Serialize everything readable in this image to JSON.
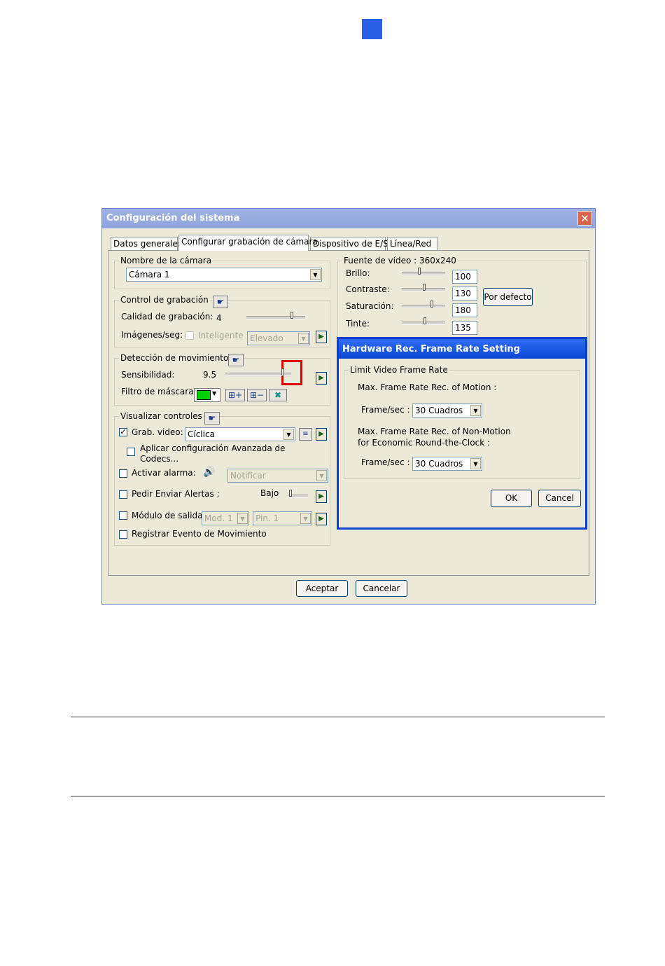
{
  "page": {
    "accent_color": "#2a5fe8"
  },
  "dialog": {
    "title": "Configuración del sistema",
    "close_glyph": "✕",
    "tabs": [
      "Datos generales",
      "Configurar grabación de cámara",
      "Dispositivo de E/S",
      "Línea/Red"
    ],
    "active_tab": 1,
    "camera_name": {
      "legend": "Nombre de la cámara",
      "value": "Cámara 1"
    },
    "recording_control": {
      "legend": "Control de grabación",
      "quality_label": "Calidad de grabación:",
      "quality_value": "4",
      "fps_label": "Imágenes/seg:",
      "smart_label": "Inteligente",
      "fps_value": "Elevado"
    },
    "motion_detection": {
      "legend": "Detección de movimiento",
      "sensitivity_label": "Sensibilidad:",
      "sensitivity_value": "9.5",
      "mask_label": "Filtro de máscara:"
    },
    "display_controls": {
      "legend": "Visualizar controles",
      "rec_video_label": "Grab. video:",
      "rec_video_value": "Cíclica",
      "rec_video_checked": true,
      "advanced_codec_label_1": "Aplicar configuración Avanzada de",
      "advanced_codec_label_2": "Codecs...",
      "alarm_label": "Activar alarma:",
      "alarm_value": "Notificar",
      "alerts_label": "Pedir Enviar Alertas :",
      "alerts_level": "Bajo",
      "output_label": "Módulo de salida:",
      "module_value": "Mod. 1",
      "pin_value": "Pin. 1",
      "register_label": "Registrar Evento de Movimiento"
    },
    "video_source": {
      "legend": "Fuente de vídeo : 360x240",
      "brightness_label": "Brillo:",
      "brightness_value": "100",
      "contrast_label": "Contraste:",
      "contrast_value": "130",
      "saturation_label": "Saturación:",
      "saturation_value": "180",
      "tint_label": "Tinte:",
      "tint_value": "135",
      "default_button": "Por defecto"
    },
    "accept_button": "Aceptar",
    "cancel_button": "Cancelar"
  },
  "hw_dialog": {
    "title": "Hardware Rec. Frame Rate Setting",
    "legend": "Limit Video Frame Rate",
    "motion_label": "Max. Frame Rate Rec. of Motion :",
    "motion_fps_label": "Frame/sec :",
    "motion_fps_value": "30 Cuadros",
    "nonmotion_label_1": "Max. Frame Rate Rec. of Non-Motion",
    "nonmotion_label_2": "for Economic Round-the-Clock :",
    "nonmotion_fps_label": "Frame/sec :",
    "nonmotion_fps_value": "30 Cuadros",
    "ok_button": "OK",
    "cancel_button": "Cancel"
  },
  "icons": {
    "play": "▶",
    "arrow_down": "▼",
    "check": "✓",
    "hand": "☛",
    "speaker": "🔊",
    "close_x": "✖",
    "add_grid": "⊞+",
    "remove_grid": "⊞−"
  }
}
